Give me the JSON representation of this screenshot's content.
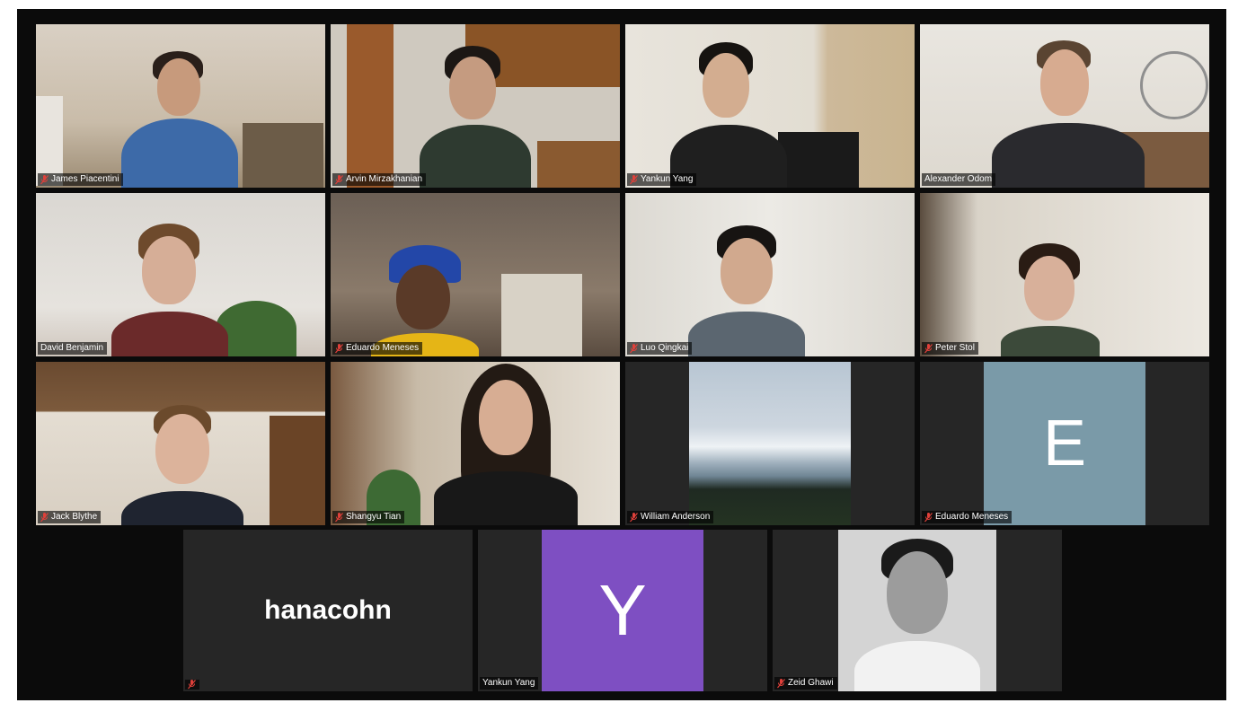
{
  "meeting": {
    "participants": [
      {
        "name": "James Piacentini",
        "muted": true,
        "video": true
      },
      {
        "name": "Arvin Mirzakhanian",
        "muted": true,
        "video": true
      },
      {
        "name": "Yankun Yang",
        "muted": true,
        "video": true
      },
      {
        "name": "Alexander Odom",
        "muted": false,
        "video": true
      },
      {
        "name": "David Benjamin",
        "muted": false,
        "video": true,
        "speaking": true
      },
      {
        "name": "Eduardo Meneses",
        "muted": true,
        "video": true
      },
      {
        "name": "Luo Qingkai",
        "muted": true,
        "video": true
      },
      {
        "name": "Peter Stol",
        "muted": true,
        "video": true
      },
      {
        "name": "Jack Blythe",
        "muted": true,
        "video": true
      },
      {
        "name": "Shangyu Tian",
        "muted": true,
        "video": true
      },
      {
        "name": "William Anderson",
        "muted": true,
        "video": false,
        "avatar": "landscape-photo"
      },
      {
        "name": "Eduardo Meneses",
        "muted": true,
        "video": false,
        "avatar_letter": "E"
      },
      {
        "name": "hanacohn",
        "muted": true,
        "video": false,
        "text_only": true
      },
      {
        "name": "Yankun Yang",
        "muted": false,
        "video": false,
        "avatar_letter": "Y"
      },
      {
        "name": "Zeid Ghawi",
        "muted": true,
        "video": false,
        "avatar": "portrait-photo"
      }
    ]
  },
  "colors": {
    "speaking_border": "#c9e04a",
    "muted_icon": "#e0403a",
    "avatar_e_bg": "#7a9aa8",
    "avatar_y_bg": "#7e4fc2",
    "tile_bg": "#262626",
    "stage_bg": "#0b0b0b"
  }
}
